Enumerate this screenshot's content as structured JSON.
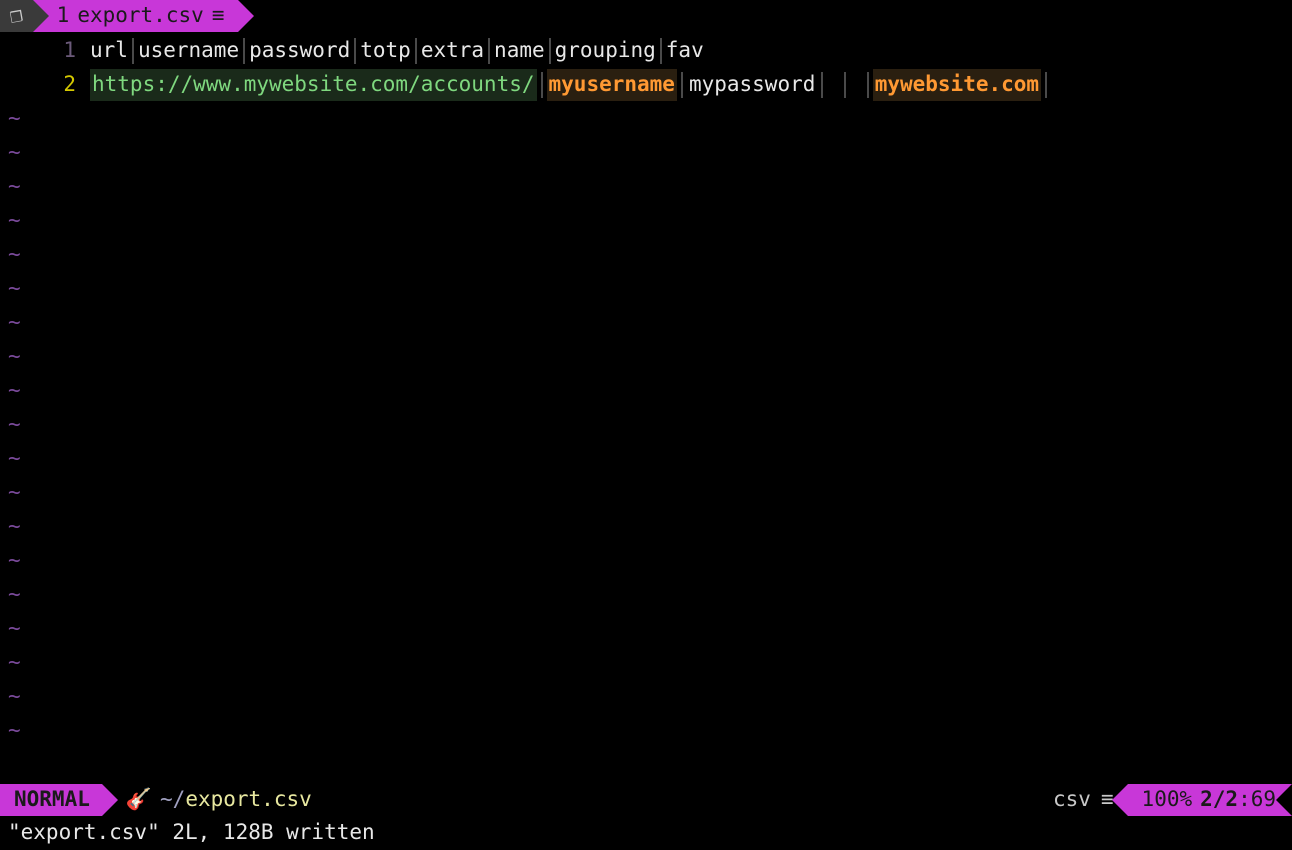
{
  "tab": {
    "index": "1",
    "filename": "export.csv"
  },
  "editor": {
    "lines": [
      {
        "num": "1",
        "current": false,
        "cells": [
          "url",
          "username",
          "password",
          "totp",
          "extra",
          "name",
          "grouping",
          "fav"
        ],
        "type": "header"
      },
      {
        "num": "2",
        "current": true,
        "cells": [
          {
            "text": "https://www.mywebsite.com/accounts/",
            "style": "url"
          },
          {
            "text": "myusername",
            "style": "orange"
          },
          {
            "text": "mypassword",
            "style": "plain"
          },
          {
            "text": "",
            "style": "empty"
          },
          {
            "text": "",
            "style": "empty"
          },
          {
            "text": "mywebsite.com",
            "style": "orange"
          }
        ],
        "type": "data"
      }
    ],
    "tilde": "~",
    "empty_rows": 19
  },
  "status": {
    "mode": "NORMAL",
    "git_icon": "🎸",
    "path_prefix": "~/",
    "path_file": "export.csv",
    "filetype": "csv",
    "percent": "100%",
    "line_pos": "2/2",
    "col_pos": ":69"
  },
  "cmdline": "\"export.csv\" 2L, 128B written"
}
